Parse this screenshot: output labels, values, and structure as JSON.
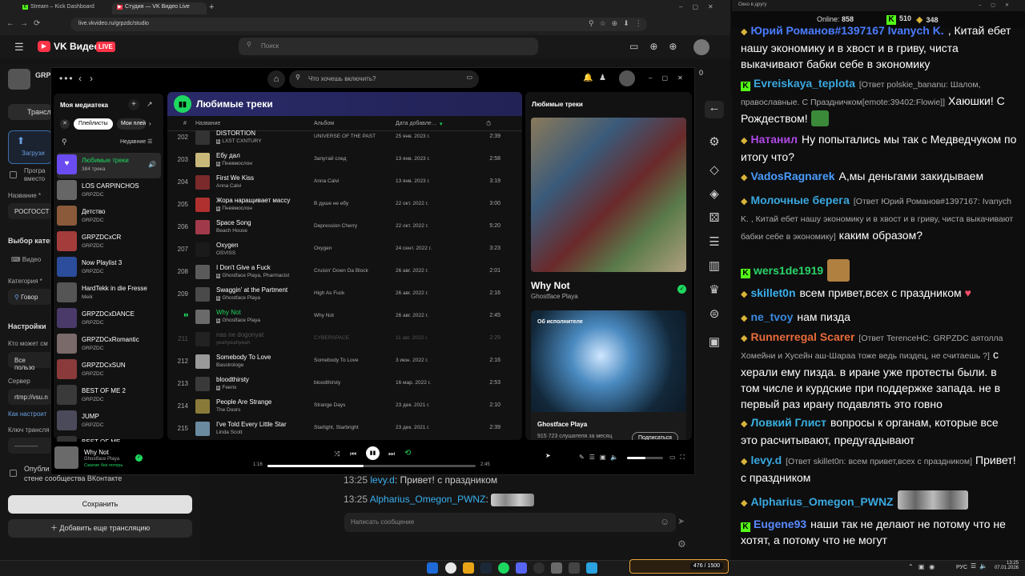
{
  "browser": {
    "tabs": [
      {
        "label": "Stream – Kick Dashboard"
      },
      {
        "label": "Студия — VK Видео Live"
      }
    ],
    "url": "live.vkvideo.ru/grpzdc/studio"
  },
  "vk": {
    "logo": "VK Видео",
    "live_badge": "LIVE",
    "search_placeholder": "Поиск",
    "channel_short": "GRP",
    "left": {
      "tab": "Трансл",
      "upload": "Загрузи",
      "checkbox1": "Програ",
      "checkbox1b": "вместо",
      "name_label": "Название *",
      "name_value": "РОСГОССТ",
      "category_title": "Выбор катег",
      "video_label": "Видео",
      "category_label": "Категория *",
      "category_value": "Говор",
      "settings_title": "Настройки",
      "who_can": "Кто может см",
      "who_value": "Все пользо",
      "server_label": "Сервер",
      "server_value": "rtmp://vsu.n",
      "how_to": "Как настроит",
      "key_label": "Ключ трансля",
      "key_value": "-----------",
      "publish_1": "Опубли",
      "publish_2": "стене сообщества ВКонтакте",
      "save": "Сохранить",
      "add": "Добавить еще трансляцию"
    },
    "right_count": "0",
    "chat_messages": [
      {
        "time": "13:25",
        "user": "levy.d",
        "text": "Привет! с праздником"
      },
      {
        "time": "13:25",
        "user": "Alpharius_Omegon_PWNZ",
        "text": ""
      }
    ],
    "chat_placeholder": "Написать сообщение"
  },
  "spotify": {
    "search_placeholder": "Что хочешь включить?",
    "library": {
      "title": "Моя медиатека",
      "chips": [
        "Плейлисты",
        "Мои плей"
      ],
      "sort": "Недавние",
      "items": [
        {
          "name": "Любимые треки",
          "sub": "384 трека",
          "color": "#6a4cf0",
          "active": true
        },
        {
          "name": "LOS CARPINCHOS",
          "sub": "GRPZDC",
          "color": "#666"
        },
        {
          "name": "Детство",
          "sub": "GRPZDC",
          "color": "#8a5a3a"
        },
        {
          "name": "GRPZDCxCR",
          "sub": "GRPZDC",
          "color": "#a43c3c"
        },
        {
          "name": "Now Playlist 3",
          "sub": "GRPZDC",
          "color": "#2c4c9c"
        },
        {
          "name": "HardTekk in die Fresse",
          "sub": "Meik",
          "color": "#555"
        },
        {
          "name": "GRPZDCxDANCE",
          "sub": "GRPZDC",
          "color": "#4a3a6a"
        },
        {
          "name": "GRPZDCxRomantic",
          "sub": "GRPZDC",
          "color": "#7a6a6a"
        },
        {
          "name": "GRPZDCxSUN",
          "sub": "GRPZDC",
          "color": "#8a3a3a"
        },
        {
          "name": "BEST OF ME 2",
          "sub": "GRPZDC",
          "color": "#3a3a3a"
        },
        {
          "name": "JUMP",
          "sub": "GRPZDC",
          "color": "#4a4a5a"
        },
        {
          "name": "BEST OF ME",
          "sub": "",
          "color": "#333"
        }
      ]
    },
    "playlist": {
      "title": "Любимые треки",
      "columns": {
        "num": "#",
        "name": "Название",
        "album": "Альбом",
        "date": "Дата добавле…",
        "dur": "⏱"
      },
      "rows": [
        {
          "n": "202",
          "title": "DISTORTION",
          "artist": "LXST CXNTURY",
          "album": "UNIVERSE OF THE PAST",
          "date": "25 янв. 2023 г.",
          "dur": "2:39",
          "color": "#333",
          "explicit": true
        },
        {
          "n": "203",
          "title": "Ебу дал",
          "artist": "Пневмослон",
          "album": "Запутай след",
          "date": "13 янв. 2023 г.",
          "dur": "2:58",
          "color": "#c8b87a",
          "explicit": true
        },
        {
          "n": "204",
          "title": "First We Kiss",
          "artist": "Anna Calvi",
          "album": "Anna Calvi",
          "date": "13 янв. 2023 г.",
          "dur": "3:19",
          "color": "#7a2a2a"
        },
        {
          "n": "205",
          "title": "Жора наращивает массу",
          "artist": "Пневмослон",
          "album": "В душе не ебу",
          "date": "22 окт. 2022 г.",
          "dur": "3:00",
          "color": "#b03030",
          "explicit": true
        },
        {
          "n": "206",
          "title": "Space Song",
          "artist": "Beach House",
          "album": "Depression Cherry",
          "date": "22 окт. 2022 г.",
          "dur": "5:20",
          "color": "#a03a4a"
        },
        {
          "n": "207",
          "title": "Oxygen",
          "artist": "OSVISS",
          "album": "Oxygen",
          "date": "24 сент. 2022 г.",
          "dur": "3:23",
          "color": "#1a1a1a"
        },
        {
          "n": "208",
          "title": "I Don't Give a Fuck",
          "artist": "Ghostface Playa, Pharmacist",
          "album": "Cruisin' Down Da Block",
          "date": "26 авг. 2022 г.",
          "dur": "2:01",
          "color": "#5a5a5a",
          "explicit": true
        },
        {
          "n": "209",
          "title": "Swaggin' at the Partment",
          "artist": "Ghostface Playa",
          "album": "High As Fuck",
          "date": "26 авг. 2022 г.",
          "dur": "2:16",
          "color": "#4a4a4a",
          "explicit": true
        },
        {
          "n": "▮▮",
          "title": "Why Not",
          "artist": "Ghostface Playa",
          "album": "Why Not",
          "date": "26 авг. 2022 г.",
          "dur": "2:45",
          "color": "#6a6a6a",
          "explicit": true,
          "playing": true
        },
        {
          "n": "211",
          "title": "nas ne dogonyat",
          "artist": "yeahyeahyeah",
          "album": "CYBERSPACE",
          "date": "11 авг. 2022 г.",
          "dur": "2:29",
          "color": "#222",
          "dim": true
        },
        {
          "n": "212",
          "title": "Somebody To Love",
          "artist": "Basstrologe",
          "album": "Somebody To Love",
          "date": "3 июн. 2022 г.",
          "dur": "2:16",
          "color": "#999"
        },
        {
          "n": "213",
          "title": "bloodthirsty",
          "artist": "Feerix",
          "album": "bloodthirsty",
          "date": "16 мар. 2022 г.",
          "dur": "2:53",
          "color": "#3a3a3a",
          "explicit": true
        },
        {
          "n": "214",
          "title": "People Are Strange",
          "artist": "The Doors",
          "album": "Strange Days",
          "date": "23 дек. 2021 г.",
          "dur": "2:10",
          "color": "#8a7a3a"
        },
        {
          "n": "215",
          "title": "I've Told Every Little Star",
          "artist": "Linda Scott",
          "album": "Starlight, Starbright",
          "date": "23 дек. 2021 г.",
          "dur": "2:39",
          "color": "#6a8aa0"
        }
      ]
    },
    "nowplaying_panel": {
      "header": "Любимые треки",
      "title": "Why Not",
      "artist": "Ghostface Playa",
      "about_label": "Об исполнителе",
      "about_artist": "Ghostface Playa",
      "listeners": "915 723 слушателя за месяц",
      "follow": "Подписаться"
    },
    "player": {
      "title": "Why Not",
      "artist": "Ghostface Playa",
      "saved": "Сжатие без потерь",
      "elapsed": "1:16",
      "total": "2:45",
      "progress": 0.46,
      "volume": 0.5
    }
  },
  "chat": {
    "window_title": "Окно в другу",
    "online_label": "Online:",
    "online_value": "858",
    "kick_count": "510",
    "vk_count": "348",
    "messages": [
      {
        "platform": "vk",
        "user": "Юрий Романов#1397167 Ivanych K.",
        "color": "#4a7cff",
        "text": ", Китай ебет нашу экономику и в хвост и в гриву, чиста выкачивают бабки себе в экономику"
      },
      {
        "platform": "kick",
        "user": "Evreiskaya_teplota",
        "color": "#3aa8e0",
        "reply": "[Ответ polskie_bananu: Шалом, православные. С Праздничком[emote:39402:Flowie]]",
        "text": "Хаюшки! С Рождеством!"
      },
      {
        "platform": "vk",
        "user": "Натанил",
        "color": "#b048e8",
        "text": "Ну попытались мы так с Медведчуком по итогу что?"
      },
      {
        "platform": "vk",
        "user": "VadosRagnarek",
        "color": "#4a9cff",
        "text": "А,мы деньгами закидываем"
      },
      {
        "platform": "vk",
        "user": "Молочные берега",
        "color": "#3aa8e0",
        "reply": "[Ответ Юрий Романов#1397167: Ivanych K. , Китай ебет нашу экономику и в хвост и в гриву, чиста выкачивают бабки себе в экономику]",
        "text": "каким образом?"
      },
      {
        "platform": "kick",
        "user": "wers1de1919",
        "color": "#2ad468",
        "text": ""
      },
      {
        "platform": "vk",
        "user": "skillet0n",
        "color": "#3ab0f0",
        "text": "всем привет,всех с праздником"
      },
      {
        "platform": "vk",
        "user": "ne_tvoy",
        "color": "#3a8ae0",
        "text": "нам пизда"
      },
      {
        "platform": "vk",
        "user": "Runnerregal Scarer",
        "color": "#e86a3a",
        "reply": "[Ответ TerenceHC: GRPZDC аятолла Хомейни и Хусейн аш-Шараа тоже ведь пиздец, не считаешь ?]",
        "text": "с херали ему пизда. в иране уже протесты были. в том числе и курдские при поддержке запада. не в первый раз ирану подавлять это говно"
      },
      {
        "platform": "vk",
        "user": "Ловкий Глист",
        "color": "#3ab0e0",
        "text": "вопросы к органам, которые все это расчитывают, предугадывают"
      },
      {
        "platform": "vk",
        "user": "levy.d",
        "color": "#3aa8e0",
        "reply": "[Ответ skillet0n: всем привет,всех с праздником]",
        "text": "Привет! с праздником"
      },
      {
        "platform": "vk",
        "user": "Alpharius_Omegon_PWNZ",
        "color": "#3aa8e0",
        "text": ""
      },
      {
        "platform": "kick",
        "user": "Eugene93",
        "color": "#5a8aff",
        "text": "наши так не делают не потому что не хотят, а потому что не могут"
      }
    ]
  },
  "taskbar": {
    "lang": "РУС",
    "time": "13:25",
    "date": "07.01.2026",
    "game_widget": "476 / 1500"
  },
  "colors": {
    "spotify_green": "#1ed760",
    "kick_green": "#53fc18",
    "vk_blue": "#0077ff",
    "live_red": "#ff3347"
  }
}
